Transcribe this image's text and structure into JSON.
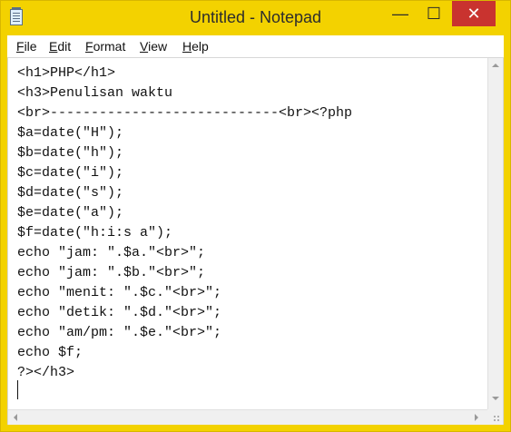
{
  "window": {
    "title": "Untitled - Notepad",
    "buttons": {
      "minimize": "—",
      "maximize": "☐",
      "close": "✕"
    }
  },
  "menu": {
    "file": {
      "first": "F",
      "rest": "ile"
    },
    "edit": {
      "first": "E",
      "rest": "dit"
    },
    "format": {
      "first": "F",
      "prefix": "",
      "rest": "ormat",
      "display": "Format"
    },
    "view": {
      "first": "V",
      "rest": "iew"
    },
    "help": {
      "first": "H",
      "rest": "elp"
    }
  },
  "editor": {
    "content": "<h1>PHP</h1>\n<h3>Penulisan waktu\n<br>----------------------------<br><?php\n$a=date(\"H\");\n$b=date(\"h\");\n$c=date(\"i\");\n$d=date(\"s\");\n$e=date(\"a\");\n$f=date(\"h:i:s a\");\necho \"jam: \".$a.\"<br>\";\necho \"jam: \".$b.\"<br>\";\necho \"menit: \".$c.\"<br>\";\necho \"detik: \".$d.\"<br>\";\necho \"am/pm: \".$e.\"<br>\";\necho $f;\n?></h3>"
  },
  "icons": {
    "app": "notepad-icon",
    "scroll_up": "arrow-up-icon",
    "scroll_down": "arrow-down-icon",
    "scroll_left": "arrow-left-icon",
    "scroll_right": "arrow-right-icon",
    "size_grip": "size-grip-icon"
  }
}
